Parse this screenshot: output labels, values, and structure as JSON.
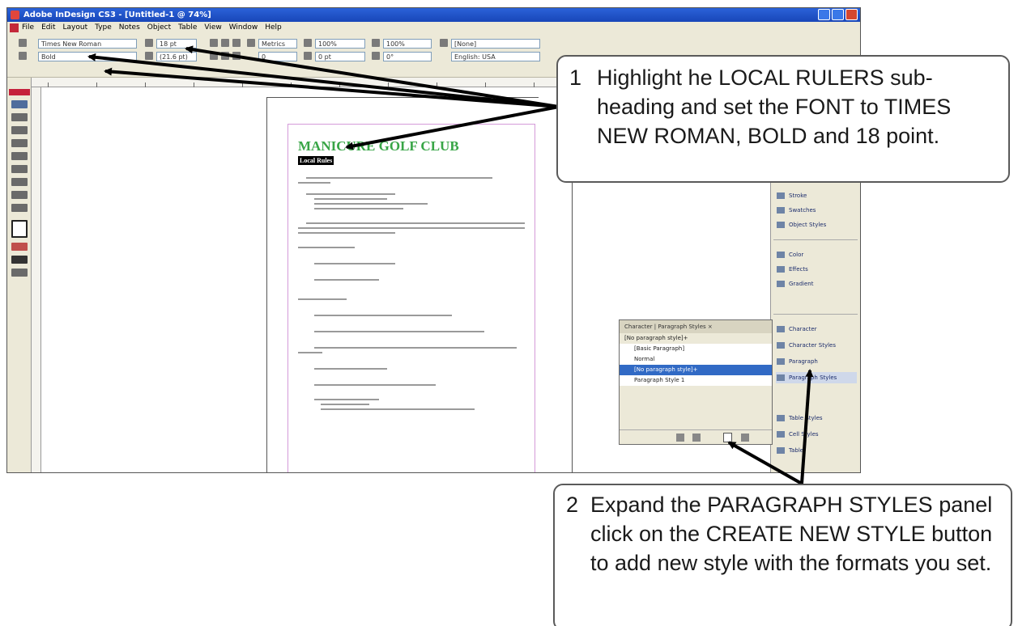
{
  "window": {
    "title": "Adobe InDesign CS3 - [Untitled-1 @ 74%]"
  },
  "menu": [
    "File",
    "Edit",
    "Layout",
    "Type",
    "Notes",
    "Object",
    "Table",
    "View",
    "Window",
    "Help"
  ],
  "control_bar": {
    "font_family": "Times New Roman",
    "font_style": "Bold",
    "font_size": "18 pt",
    "leading": "(21.6 pt)",
    "kerning": "Metrics",
    "vertical_scale": "100%",
    "horizontal_scale": "100%",
    "baseline_shift": "0 pt",
    "skew": "0°",
    "tracking": "0",
    "character_style": "[None]",
    "language": "English: USA"
  },
  "document": {
    "title": "MANICURE GOLF CLUB",
    "selected_subheading": "Local Rules"
  },
  "panels": {
    "paragraph_styles_panel": {
      "tabs": "Character | Paragraph Styles ×",
      "current": "[No paragraph style]+",
      "styles": [
        "[Basic Paragraph]",
        "Normal",
        "[No paragraph style]+",
        "Paragraph Style 1"
      ],
      "selected_index": 2
    },
    "dock": [
      "Stroke",
      "Swatches",
      "Object Styles",
      "Color",
      "Effects",
      "Gradient",
      "Character",
      "Character Styles",
      "Paragraph",
      "Paragraph Styles",
      "Table Styles",
      "Cell Styles",
      "Table"
    ]
  },
  "callouts": [
    {
      "number": "1",
      "text": "Highlight he LOCAL RULERS sub-heading and set the FONT to TIMES NEW ROMAN, BOLD and 18 point."
    },
    {
      "number": "2",
      "text": "Expand the PARAGRAPH STYLES panel click on the CREATE NEW STYLE button to add new style with the formats you set."
    }
  ]
}
